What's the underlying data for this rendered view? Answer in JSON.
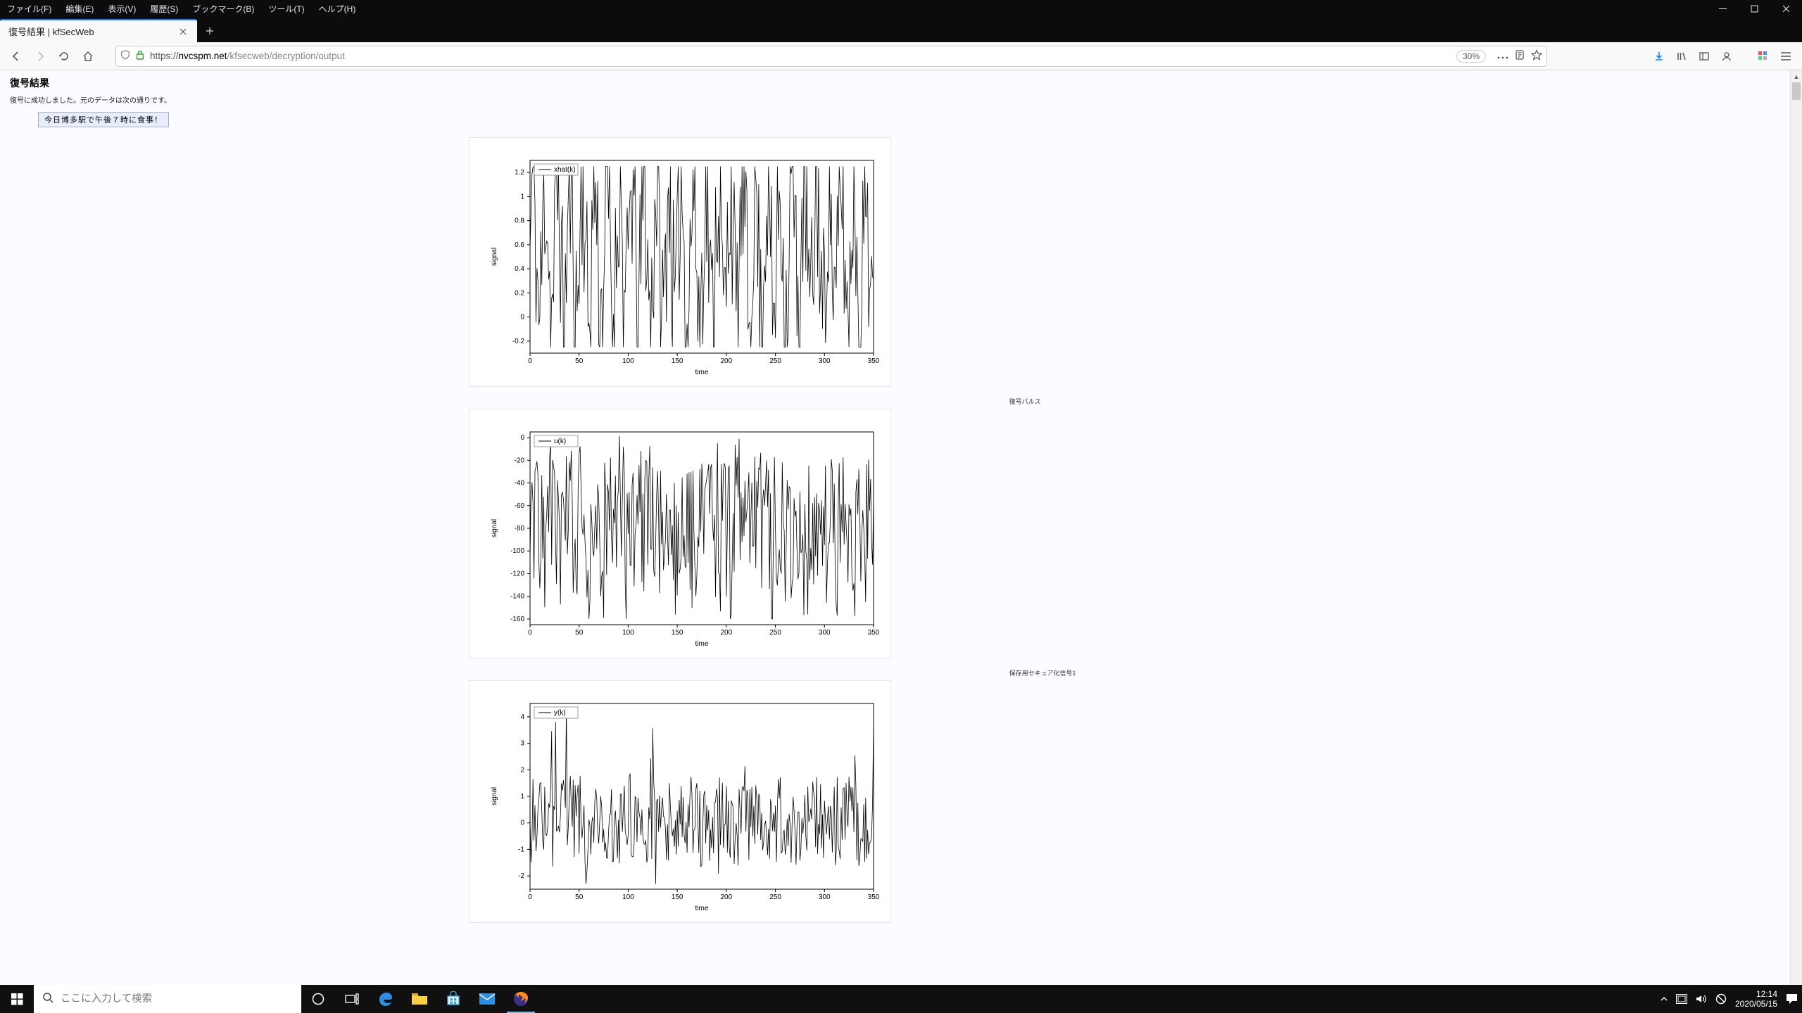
{
  "window": {
    "menus": [
      "ファイル(F)",
      "編集(E)",
      "表示(V)",
      "履歴(S)",
      "ブックマーク(B)",
      "ツール(T)",
      "ヘルプ(H)"
    ],
    "tab_title": "復号結果 | kfSecWeb",
    "url_prefix": "https://",
    "url_domain": "nvcspm.net",
    "url_path": "/kfsecweb/decryption/output",
    "zoom_label": "30%"
  },
  "page": {
    "header": "復号結果",
    "note": "復号に成功しました。元のデータは次の通りです。",
    "decoded_text": "今日博多駅で午後７時に食事！",
    "caption1": "復号パルス",
    "caption2": "保存用セキュア化信号1"
  },
  "taskbar": {
    "search_placeholder": "ここに入力して検索",
    "time": "12:14",
    "date": "2020/05/15"
  },
  "chart_data": [
    {
      "type": "line",
      "series_name": "xhat(k)",
      "xlabel": "time",
      "ylabel": "signal",
      "xlim": [
        0,
        350
      ],
      "ylim": [
        -0.3,
        1.3
      ],
      "xticks": [
        0,
        50,
        100,
        150,
        200,
        250,
        300,
        350
      ],
      "yticks": [
        -0.2,
        0.0,
        0.2,
        0.4,
        0.6,
        0.8,
        1.0,
        1.2
      ],
      "values_summary": "noisy signal oscillating mostly between -0.2 and 1.2 over ~350 samples"
    },
    {
      "type": "line",
      "series_name": "u(k)",
      "xlabel": "time",
      "ylabel": "signal",
      "xlim": [
        0,
        350
      ],
      "ylim": [
        -165,
        5
      ],
      "xticks": [
        0,
        50,
        100,
        150,
        200,
        250,
        300,
        350
      ],
      "yticks": [
        -160,
        -140,
        -120,
        -100,
        -80,
        -60,
        -40,
        -20,
        0
      ],
      "values_summary": "downward-dense noisy signal ranging roughly 0 to -150 over ~350 samples"
    },
    {
      "type": "line",
      "series_name": "y(k)",
      "xlabel": "time",
      "ylabel": "signal",
      "xlim": [
        0,
        350
      ],
      "ylim": [
        -2.5,
        4.5
      ],
      "xticks": [
        0,
        50,
        100,
        150,
        200,
        250,
        300,
        350
      ],
      "yticks": [
        -2,
        -1,
        0,
        1,
        2,
        3,
        4
      ],
      "values_summary": "noisy zero-mean-ish signal with occasional spikes up to ~4 and down to ~-2 over ~350 samples"
    }
  ]
}
